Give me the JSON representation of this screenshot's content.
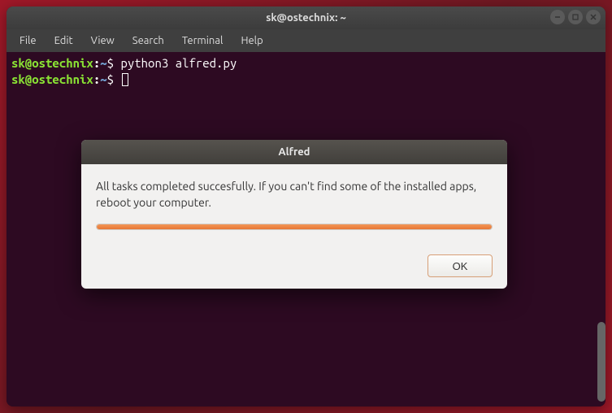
{
  "titlebar": {
    "title": "sk@ostechnix: ~"
  },
  "menubar": {
    "file": "File",
    "edit": "Edit",
    "view": "View",
    "search": "Search",
    "terminal": "Terminal",
    "help": "Help"
  },
  "terminal": {
    "line1": {
      "user": "sk@ostechnix",
      "colon": ":",
      "path": "~",
      "dollar": "$ ",
      "cmd": "python3 alfred.py"
    },
    "line2": {
      "user": "sk@ostechnix",
      "colon": ":",
      "path": "~",
      "dollar": "$ "
    }
  },
  "dialog": {
    "title": "Alfred",
    "message": "All tasks completed succesfully. If you can't find some of the installed apps, reboot your computer.",
    "ok": "OK",
    "progress_percent": 100
  }
}
